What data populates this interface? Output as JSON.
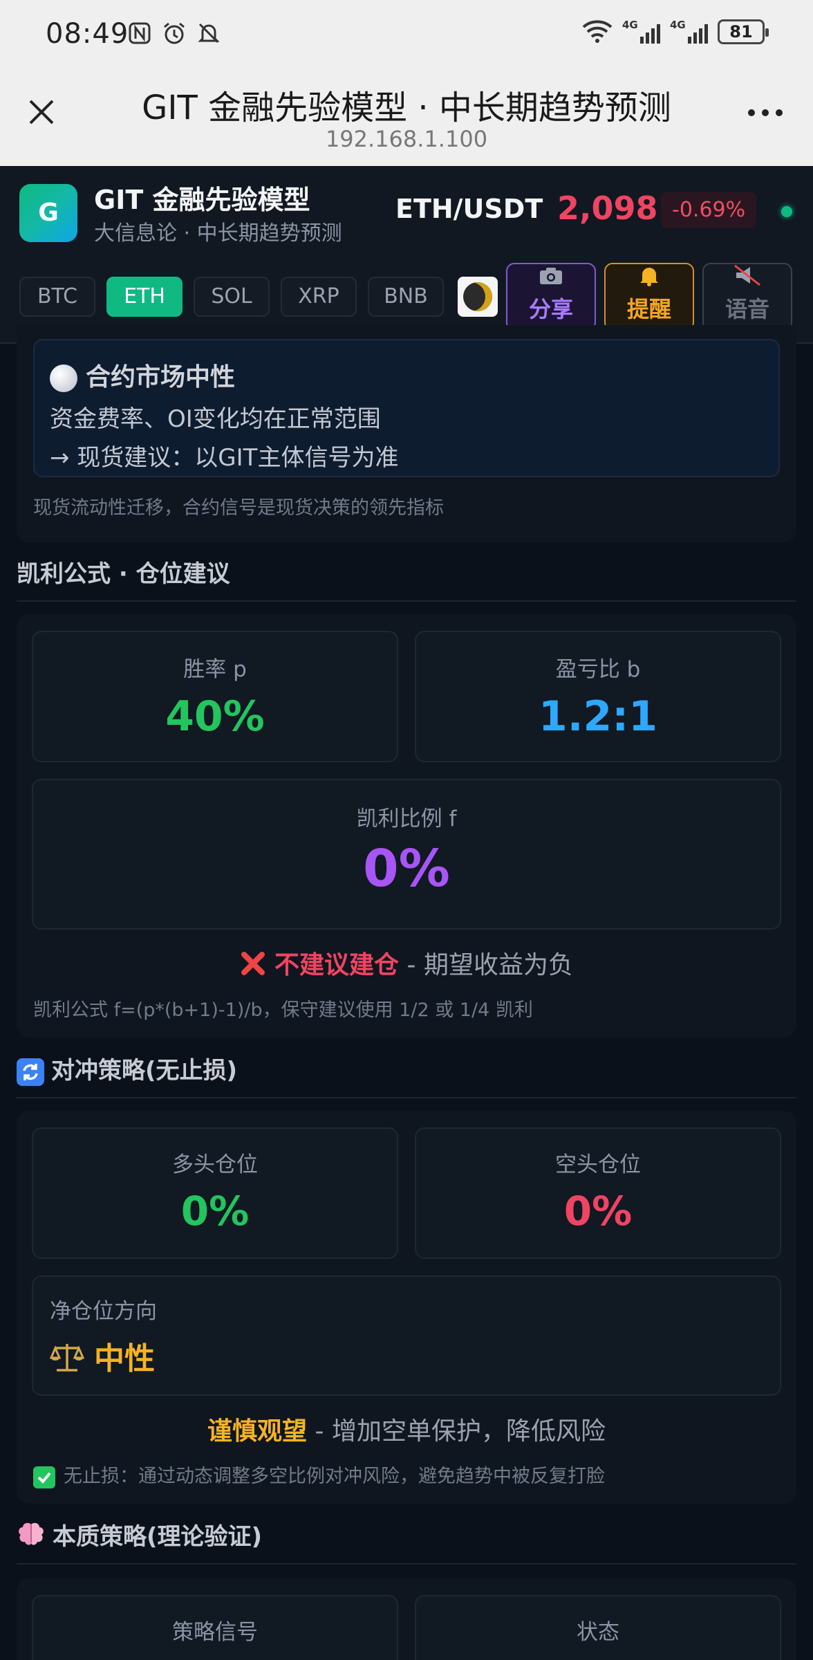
{
  "status_bar": {
    "time": "08:49",
    "signal1": "4G",
    "signal2": "4G",
    "battery": "81"
  },
  "browser": {
    "title": "GIT 金融先验模型 · 中长期趋势预测",
    "url": "192.168.1.100"
  },
  "header": {
    "logo": "G",
    "app_name": "GIT 金融先验模型",
    "subtitle": "大信息论 · 中长期趋势预测",
    "pair": "ETH/USDT",
    "price": "2,098",
    "change": "-0.69%",
    "coins": [
      "BTC",
      "ETH",
      "SOL",
      "XRP",
      "BNB"
    ],
    "active_coin": "ETH",
    "share_label": "分享",
    "alert_label": "提醒",
    "voice_label": "语音"
  },
  "contract": {
    "status": "合约市场中性",
    "line1": "资金费率、OI变化均在正常范围",
    "line2": "→ 现货建议：以GIT主体信号为准",
    "footnote": "现货流动性迁移，合约信号是现货决策的领先指标"
  },
  "kelly": {
    "section_title": "凯利公式 · 仓位建议",
    "win_rate_label": "胜率 p",
    "win_rate": "40%",
    "ratio_label": "盈亏比 b",
    "ratio": "1.2:1",
    "fraction_label": "凯利比例 f",
    "fraction": "0%",
    "verdict": "不建议建仓",
    "verdict_note": "- 期望收益为负",
    "formula": "凯利公式 f=(p*(b+1)-1)/b，保守建议使用 1/2 或 1/4 凯利"
  },
  "hedge": {
    "section_title": "对冲策略(无止损)",
    "long_label": "多头仓位",
    "long": "0%",
    "short_label": "空头仓位",
    "short": "0%",
    "net_label": "净仓位方向",
    "net": "中性",
    "advice": "谨慎观望",
    "advice_note": "- 增加空单保护，降低风险",
    "note": "无止损：通过动态调整多空比例对冲风险，避免趋势中被反复打脸"
  },
  "essence": {
    "section_title": "本质策略(理论验证)",
    "signal_label": "策略信号",
    "state_label": "状态"
  },
  "colors": {
    "green": "#22c55e",
    "red": "#f04462",
    "blue": "#2ea8ff",
    "purple": "#a855f7",
    "gold": "#f5b323"
  }
}
